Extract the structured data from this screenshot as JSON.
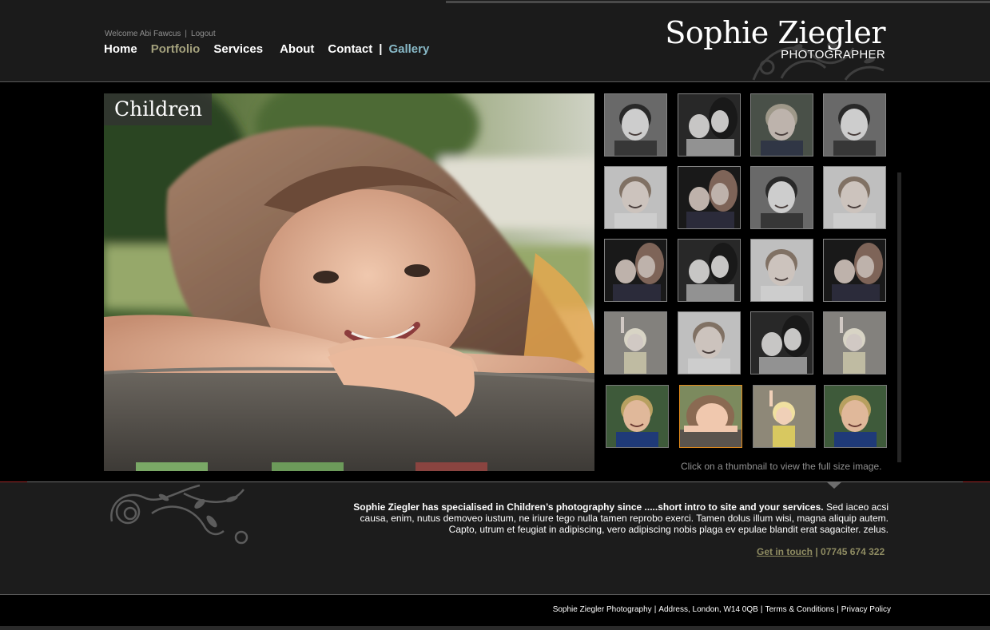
{
  "header": {
    "welcome_text": "Welcome Abi Fawcus",
    "separator": "|",
    "logout_label": "Logout",
    "brand_name": "Sophie Ziegler",
    "brand_subtitle": "PHOTOGRAPHER"
  },
  "nav": {
    "home": "Home",
    "portfolio": "Portfolio",
    "services": "Services",
    "about": "About",
    "contact": "Contact",
    "separator": "|",
    "gallery": "Gallery"
  },
  "gallery": {
    "title": "Children",
    "hint": "Click on a thumbnail to view the full size image.",
    "thumbnails": [
      {
        "subject": "boy-portrait",
        "style": "gray"
      },
      {
        "subject": "mother-baby",
        "style": "gray"
      },
      {
        "subject": "boy-blue-shirt",
        "style": "gray"
      },
      {
        "subject": "boy-portrait",
        "style": "gray"
      },
      {
        "subject": "girl-red-hair",
        "style": "gray"
      },
      {
        "subject": "mother-girl",
        "style": "gray"
      },
      {
        "subject": "boy-portrait",
        "style": "gray"
      },
      {
        "subject": "girl-red-hair",
        "style": "gray"
      },
      {
        "subject": "mother-girl",
        "style": "gray"
      },
      {
        "subject": "mother-baby",
        "style": "gray"
      },
      {
        "subject": "girl-red-hair",
        "style": "gray"
      },
      {
        "subject": "mother-girl",
        "style": "gray"
      },
      {
        "subject": "toddler-wall",
        "style": "gray"
      },
      {
        "subject": "girl-red-hair",
        "style": "gray"
      },
      {
        "subject": "mother-baby",
        "style": "gray"
      },
      {
        "subject": "toddler-wall",
        "style": "gray"
      },
      {
        "subject": "boy-blue-shirt",
        "style": "color"
      },
      {
        "subject": "girl-bench",
        "style": "active"
      },
      {
        "subject": "toddler-wall",
        "style": "color"
      },
      {
        "subject": "boy-blue-shirt",
        "style": "color"
      }
    ]
  },
  "info": {
    "intro_bold": "Sophie Ziegler has specialised in Children’s photography since .....short intro to site and your services.",
    "intro_text": " Sed iaceo acsi causa, enim, nutus demoveo iustum, ne iriure tego nulla tamen reprobo exerci. Tamen dolus illum wisi, magna aliquip autem. Capto, utrum et feugiat in adipiscing, vero adipiscing nobis plaga ev epulae blandit erat sagaciter. zelus.",
    "cta_label": "Get in touch",
    "cta_separator": " | ",
    "phone": "07745 674 322"
  },
  "footer": {
    "company": "Sophie Ziegler Photography",
    "address": "Address, London, W14 0QB",
    "terms": "Terms & Conditions",
    "privacy": "Privacy Policy",
    "separator": "|"
  },
  "colors": {
    "accent_olive": "#a3a07c",
    "accent_blue": "#88b9c7",
    "active_thumb_border": "#e08a1c",
    "header_bg": "#1b1b1b",
    "red_rule": "#9c2424"
  }
}
